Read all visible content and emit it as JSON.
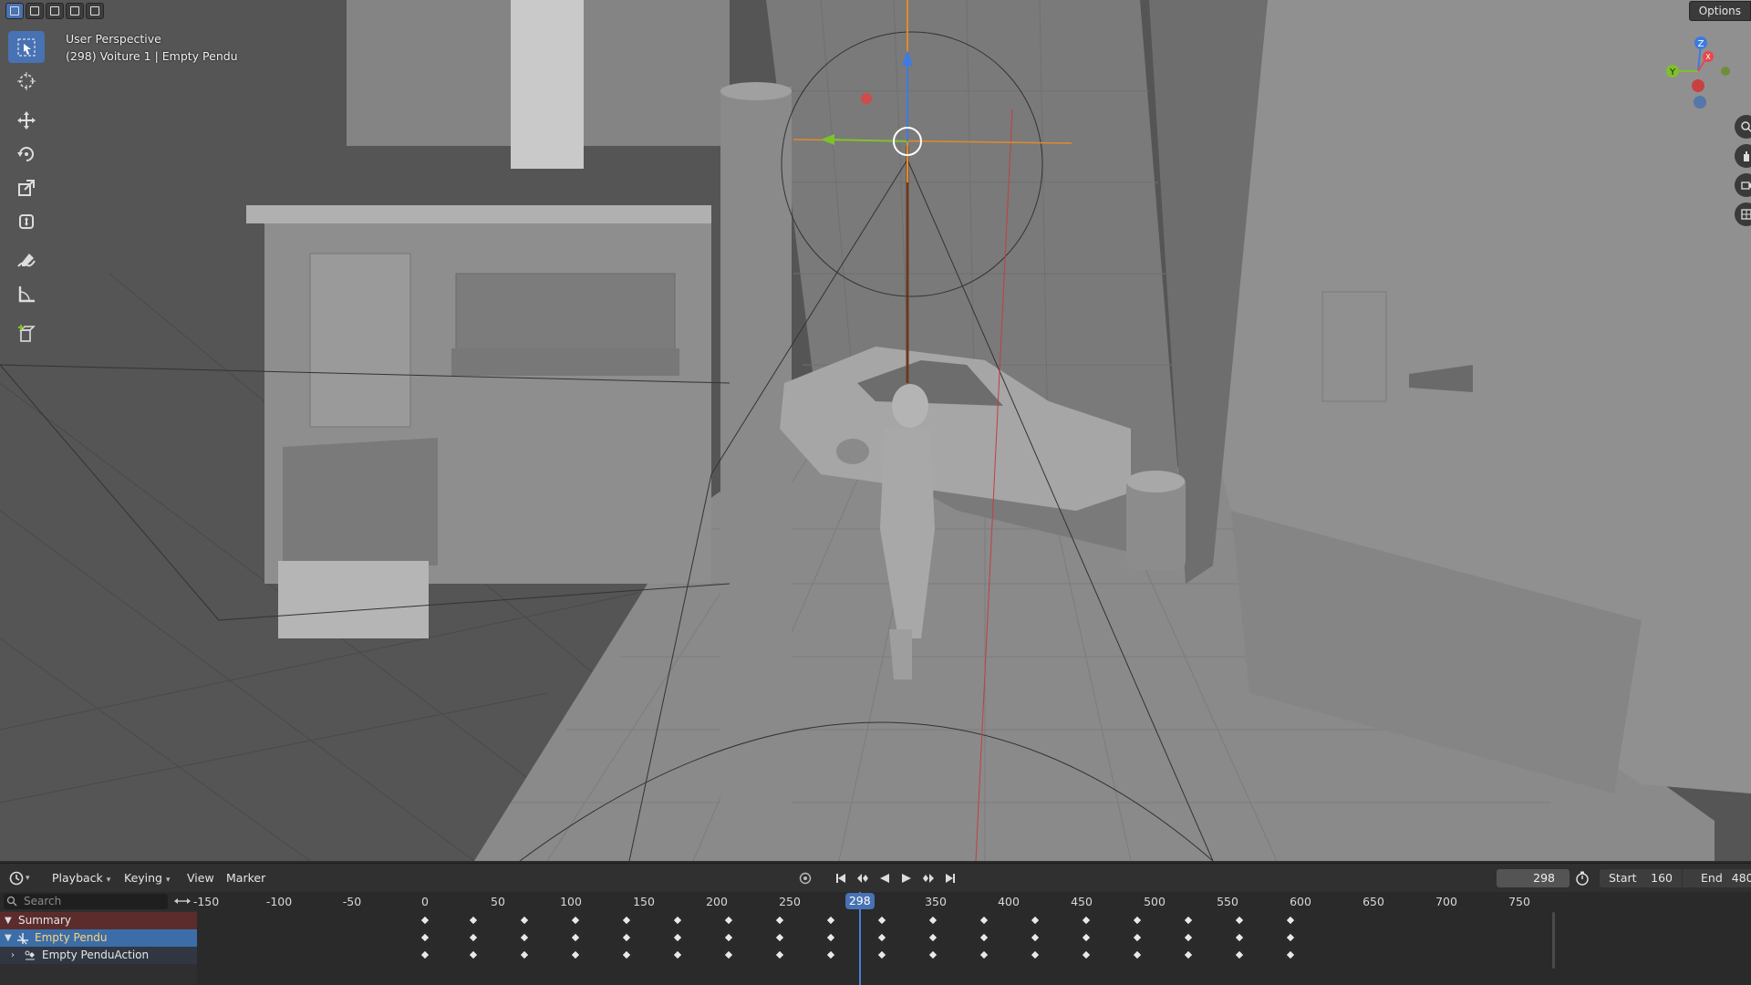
{
  "viewport": {
    "mode_label": "User Perspective",
    "object_label": "(298) Voiture 1 | Empty Pendu",
    "options_label": "Options"
  },
  "toolbar": {
    "tools": [
      "select-box",
      "cursor",
      "move",
      "rotate",
      "scale",
      "transform",
      "annotate",
      "measure",
      "add-cube"
    ],
    "active": "select-box"
  },
  "gizmo": {
    "axes": {
      "z": "Z",
      "y": "Y",
      "x": "X"
    },
    "colors": {
      "x": "#e5484d",
      "y": "#7ec12b",
      "z": "#3e7be0"
    }
  },
  "timeline": {
    "menus": {
      "playback": "Playback",
      "keying": "Keying",
      "view": "View",
      "marker": "Marker"
    },
    "current_frame": "298",
    "start_label": "Start",
    "start_value": "160",
    "end_label": "End",
    "end_value": "480",
    "search_placeholder": "Search",
    "channels": {
      "summary": "Summary",
      "object": "Empty Pendu",
      "action": "Empty PenduAction"
    },
    "ruler_labels": [
      "-150",
      "-100",
      "-50",
      "0",
      "50",
      "100",
      "150",
      "200",
      "250",
      "298",
      "350",
      "400",
      "450",
      "500",
      "550",
      "600",
      "650",
      "700",
      "750"
    ],
    "ruler_frames": [
      -150,
      -100,
      -50,
      0,
      50,
      100,
      150,
      200,
      250,
      298,
      350,
      400,
      450,
      500,
      550,
      600,
      650,
      700,
      750
    ],
    "keyframes": [
      0,
      33,
      68,
      103,
      138,
      173,
      208,
      243,
      278,
      313,
      348,
      383,
      418,
      453,
      488,
      523,
      558,
      593
    ]
  },
  "colors": {
    "accent": "#4772b3",
    "summary_row": "#5c2c2c",
    "selected_channel": "#3b6ea8"
  }
}
